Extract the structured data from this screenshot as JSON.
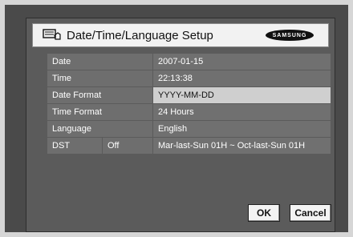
{
  "window": {
    "title": "Date/Time/Language Setup",
    "brand": "SAMSUNG",
    "title_icon": "monitor-hand-icon"
  },
  "settings": {
    "date": {
      "label": "Date",
      "value": "2007-01-15"
    },
    "time": {
      "label": "Time",
      "value": "22:13:38"
    },
    "date_format": {
      "label": "Date Format",
      "value": "YYYY-MM-DD"
    },
    "time_format": {
      "label": "Time Format",
      "value": "24 Hours"
    },
    "language": {
      "label": "Language",
      "value": "English"
    },
    "dst": {
      "label": "DST",
      "toggle": "Off",
      "value": "Mar-last-Sun 01H ~ Oct-last-Sun 01H"
    }
  },
  "buttons": {
    "ok": "OK",
    "cancel": "Cancel"
  },
  "colors": {
    "highlight_row": "#cfcfcf",
    "dialog_bg": "#5b5b5b"
  }
}
